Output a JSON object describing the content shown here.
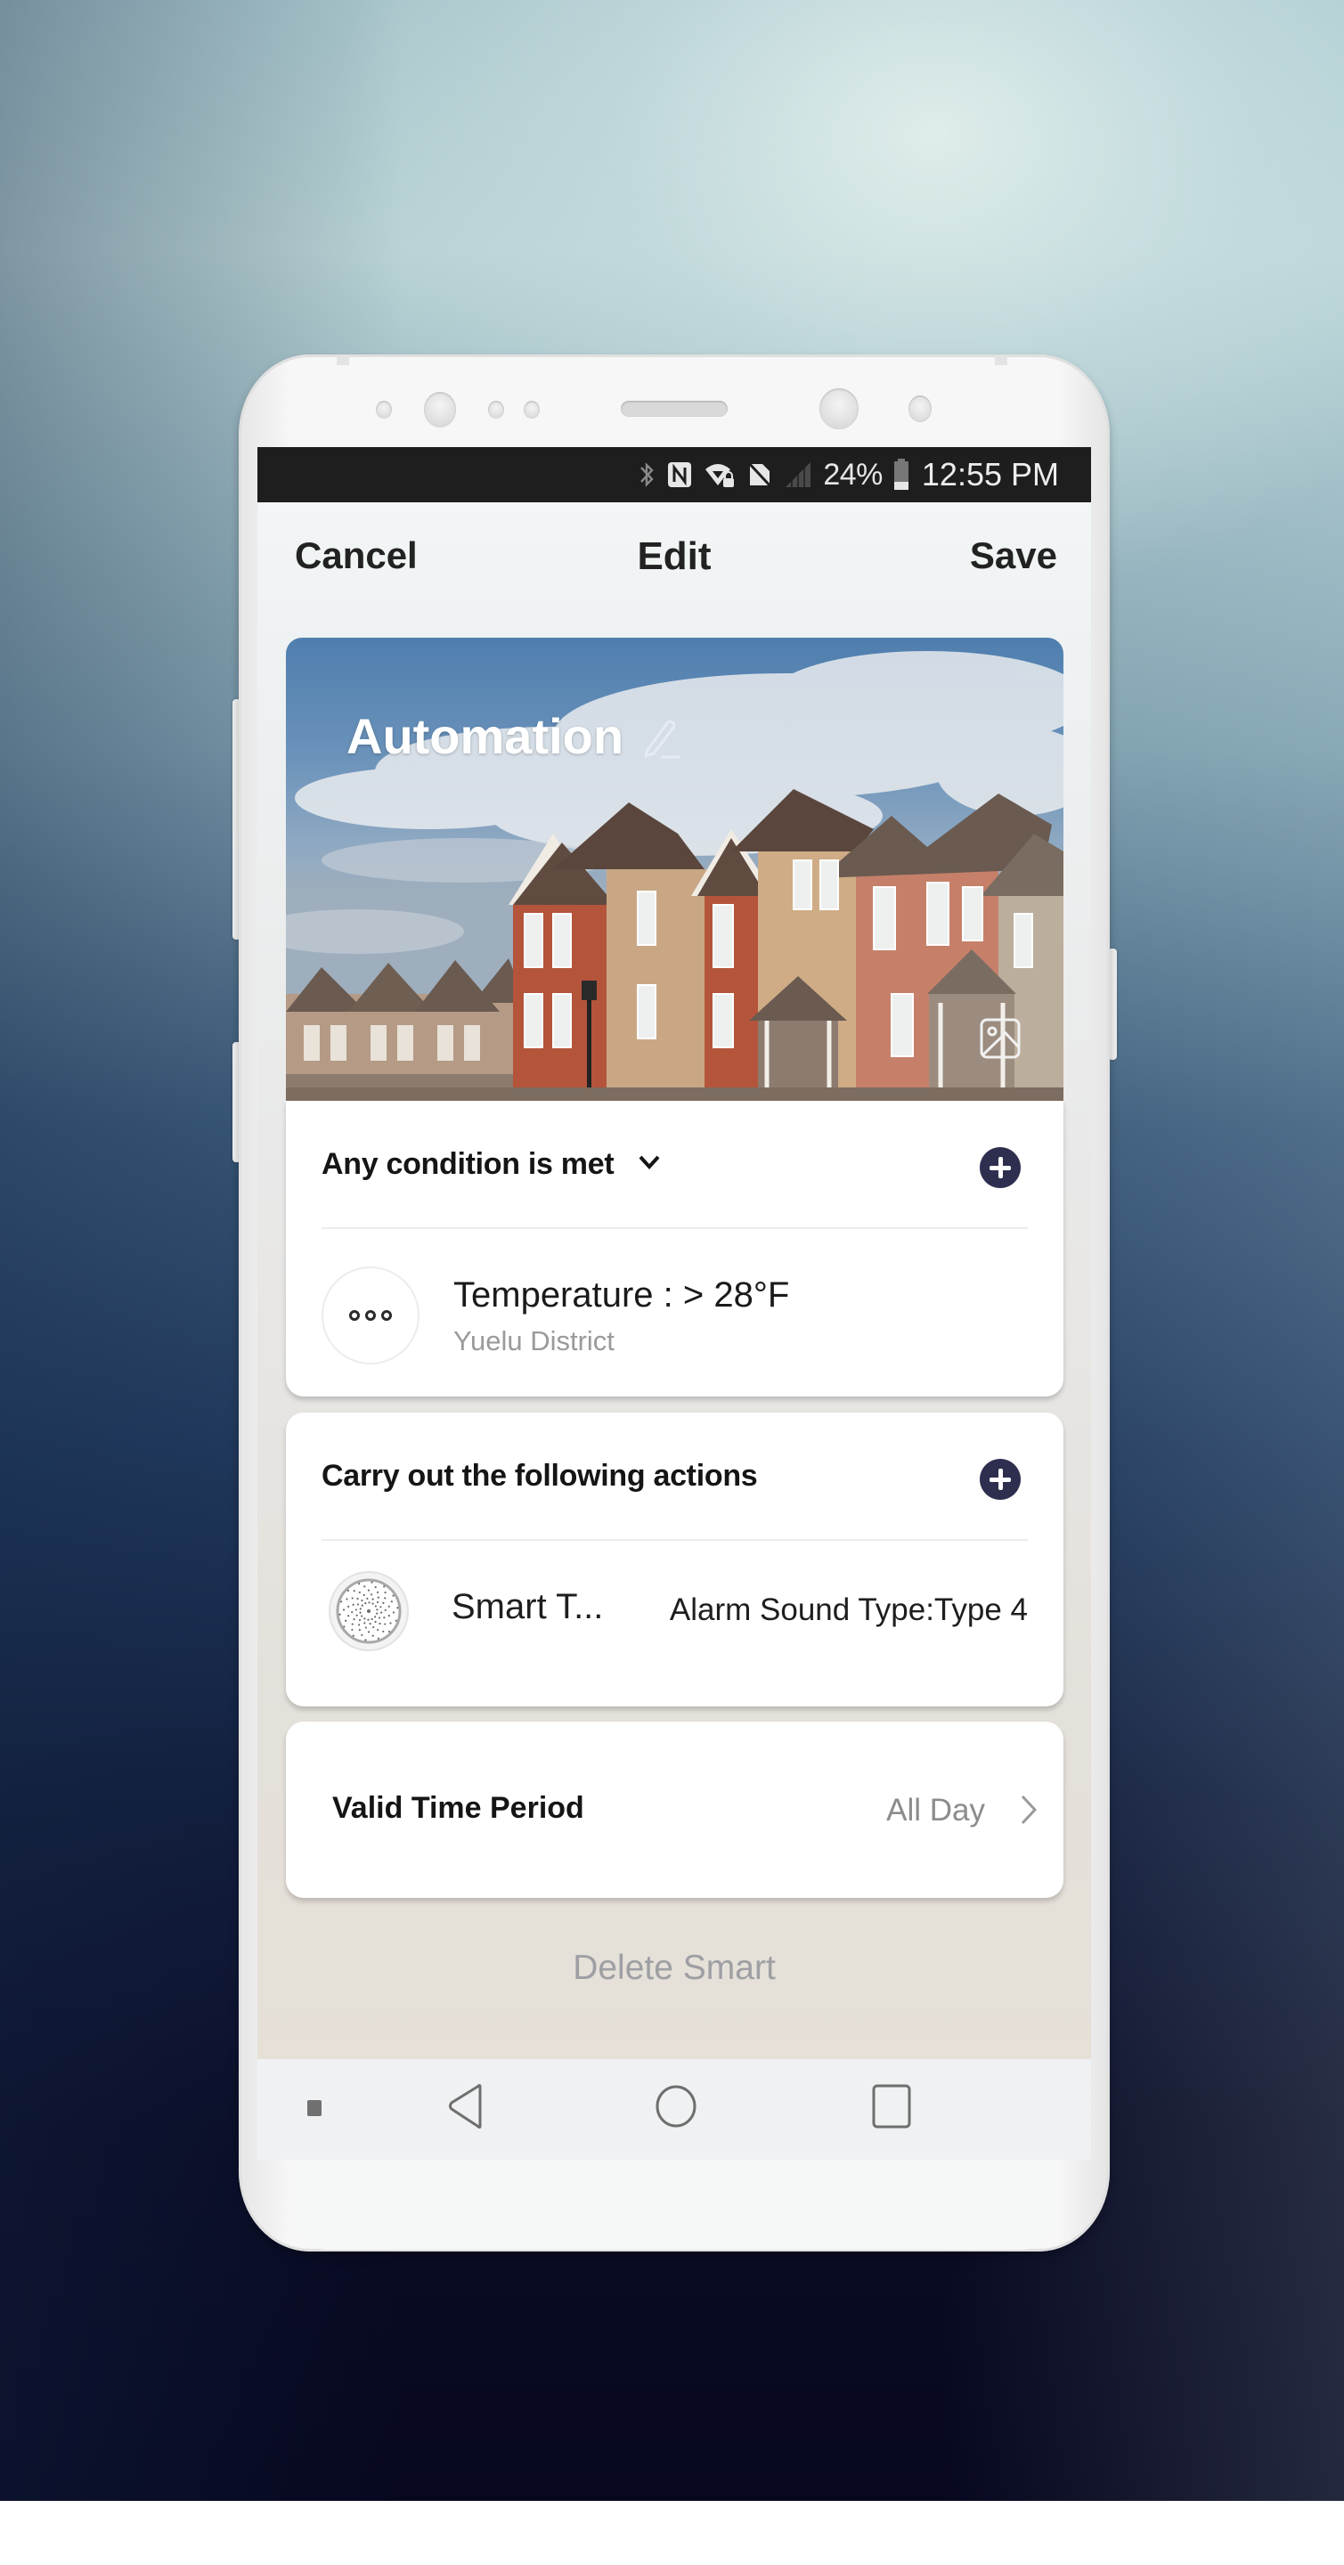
{
  "status_bar": {
    "icons": [
      "bluetooth-icon",
      "nfc-icon",
      "wifi-locked-icon",
      "no-sim-icon",
      "signal-icon",
      "battery-icon"
    ],
    "battery_percent": "24%",
    "time": "12:55 PM"
  },
  "header": {
    "cancel_label": "Cancel",
    "title": "Edit",
    "save_label": "Save"
  },
  "banner": {
    "title": "Automation",
    "edit_icon": "pencil-icon",
    "change_image_icon": "image-icon"
  },
  "conditions": {
    "header_label": "Any condition is met",
    "dropdown_icon": "chevron-down-icon",
    "add_icon": "plus-icon",
    "items": [
      {
        "icon": "more-dots-icon",
        "title": "Temperature : > 28°F",
        "subtitle": "Yuelu District"
      }
    ]
  },
  "actions": {
    "header_label": "Carry out the following actions",
    "add_icon": "plus-icon",
    "items": [
      {
        "icon": "smart-siren-icon",
        "device_name": "Smart T...",
        "value": "Alarm Sound Type:Type 4"
      }
    ]
  },
  "valid_time": {
    "label": "Valid Time Period",
    "value": "All Day",
    "chevron_icon": "chevron-right-icon"
  },
  "delete_label": "Delete Smart",
  "android_nav": {
    "keys": [
      "menu-dot-icon",
      "back-icon",
      "home-icon",
      "recents-icon"
    ]
  },
  "colors": {
    "accent_button": "#2e2f4f",
    "status_bar": "#1e1e1e",
    "primary_text": "#1a1a1a",
    "secondary_text": "#9a9a9a",
    "delete_text": "#9e9fa4"
  }
}
